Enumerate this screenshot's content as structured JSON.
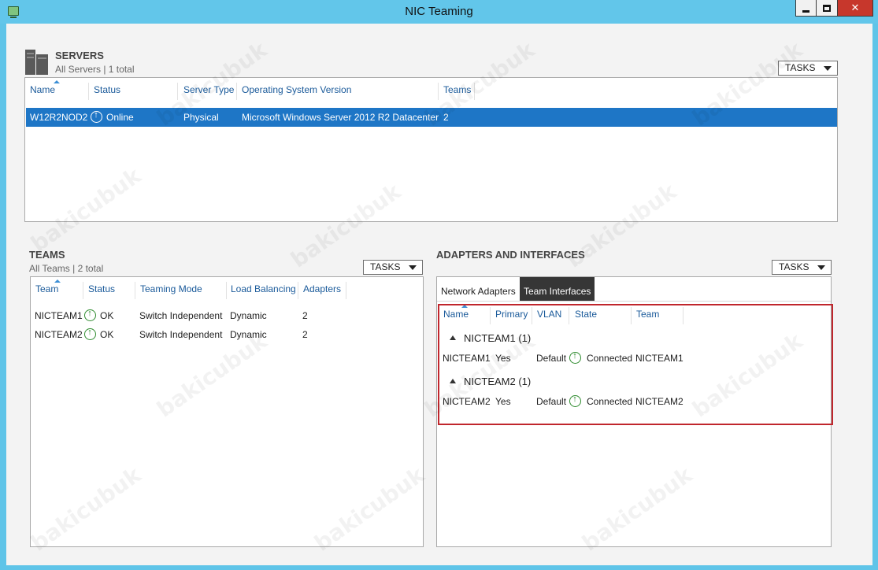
{
  "window": {
    "title": "NIC Teaming",
    "close_glyph": "✕"
  },
  "servers": {
    "title": "SERVERS",
    "subtitle": "All Servers | 1 total",
    "tasks_label": "TASKS",
    "columns": [
      "Name",
      "Status",
      "Server Type",
      "Operating System Version",
      "Teams"
    ],
    "rows": [
      {
        "name": "W12R2NOD2",
        "status": "Online",
        "type": "Physical",
        "os": "Microsoft Windows Server 2012 R2 Datacenter",
        "teams": "2"
      }
    ]
  },
  "teams": {
    "title": "TEAMS",
    "subtitle": "All Teams | 2 total",
    "tasks_label": "TASKS",
    "columns": [
      "Team",
      "Status",
      "Teaming Mode",
      "Load Balancing",
      "Adapters"
    ],
    "rows": [
      {
        "team": "NICTEAM1",
        "status": "OK",
        "mode": "Switch Independent",
        "lb": "Dynamic",
        "adapters": "2"
      },
      {
        "team": "NICTEAM2",
        "status": "OK",
        "mode": "Switch Independent",
        "lb": "Dynamic",
        "adapters": "2"
      }
    ]
  },
  "adapters": {
    "title": "ADAPTERS AND INTERFACES",
    "tasks_label": "TASKS",
    "tabs": [
      "Network Adapters",
      "Team Interfaces"
    ],
    "active_tab": "Team Interfaces",
    "columns": [
      "Name",
      "Primary",
      "VLAN",
      "State",
      "Team"
    ],
    "groups": [
      {
        "label": "NICTEAM1 (1)",
        "row": {
          "name": "NICTEAM1",
          "primary": "Yes",
          "vlan": "Default",
          "state": "Connected",
          "team": "NICTEAM1"
        }
      },
      {
        "label": "NICTEAM2 (1)",
        "row": {
          "name": "NICTEAM2",
          "primary": "Yes",
          "vlan": "Default",
          "state": "Connected",
          "team": "NICTEAM2"
        }
      }
    ]
  },
  "watermark": {
    "text": "bakicubuk"
  },
  "colors": {
    "titlebar": "#62c6ea",
    "selection": "#1e76c6",
    "header_text": "#1a5a9a",
    "highlight_border": "#c0262c",
    "status_ok": "#2e8b2e"
  },
  "icons": [
    "app-icon",
    "servers-icon",
    "status-up-icon",
    "collapse-triangle-icon",
    "dropdown-caret-icon",
    "sort-arrow-icon"
  ]
}
